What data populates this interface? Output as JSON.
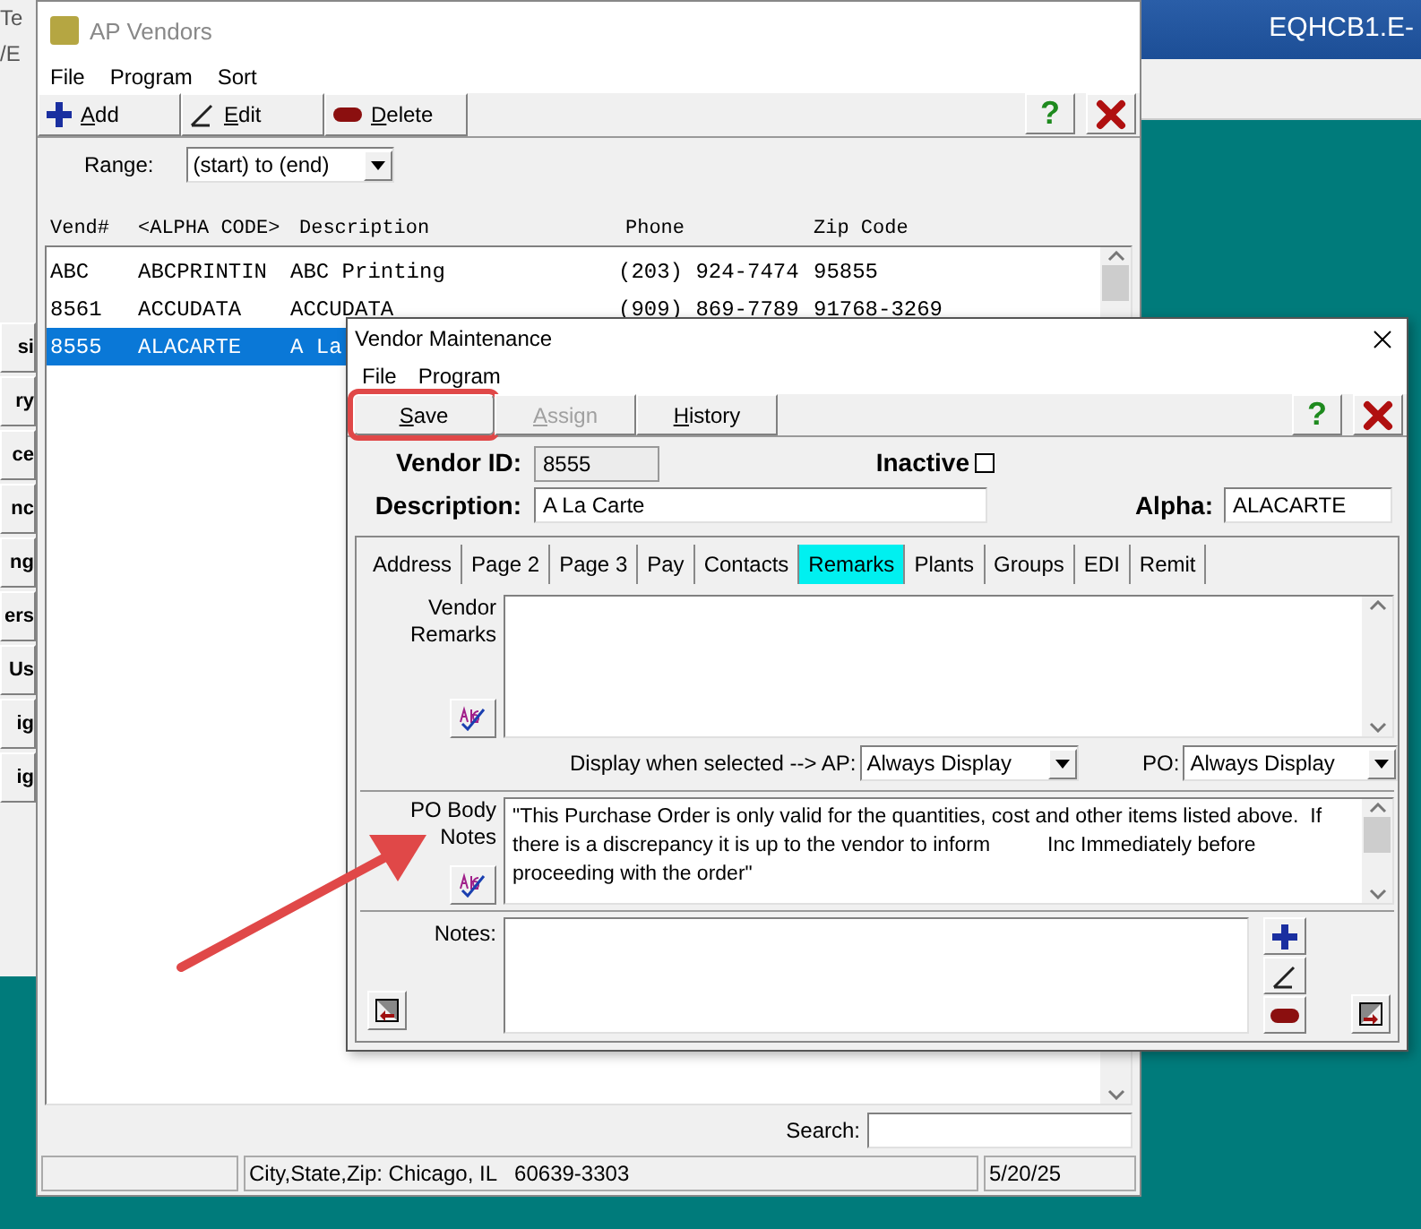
{
  "background_window": {
    "title_fragment": "EQHCB1.E-",
    "left_fragments": [
      "Te",
      "/E"
    ],
    "side_buttons": [
      "si",
      "ry",
      "ce",
      "nc",
      "ng",
      "ers",
      "Us",
      "ig",
      "ig"
    ]
  },
  "ap_vendors": {
    "title": "AP Vendors",
    "menu": [
      "File",
      "Program",
      "Sort"
    ],
    "toolbar": [
      {
        "label": "Add",
        "kind": "add"
      },
      {
        "label": "Edit",
        "kind": "edit"
      },
      {
        "label": "Delete",
        "kind": "delete"
      }
    ],
    "range": {
      "label": "Range:",
      "value": "(start) to (end)"
    },
    "columns": [
      "Vend#",
      "<ALPHA CODE>",
      "Description",
      "Phone",
      "Zip Code"
    ],
    "rows": [
      {
        "vend": "ABC",
        "alpha": "ABCPRINTIN",
        "description": "ABC Printing",
        "phone": "(203) 924-7474",
        "zip": "95855",
        "selected": false
      },
      {
        "vend": "8561",
        "alpha": "ACCUDATA",
        "description": "ACCUDATA",
        "phone": "(909) 869-7789",
        "zip": "91768-3269",
        "selected": false
      },
      {
        "vend": "8555",
        "alpha": "ALACARTE",
        "description": "A La",
        "selected": true
      }
    ],
    "search": {
      "label": "Search:"
    },
    "status_bar": [
      "City,State,Zip: Chicago, IL   60639-3303",
      "5/20/25"
    ]
  },
  "vendor_maintenance": {
    "title": "Vendor Maintenance",
    "menu": [
      "File",
      "Program"
    ],
    "toolbar": [
      {
        "label": "Save",
        "disabled": false
      },
      {
        "label": "Assign",
        "disabled": true
      },
      {
        "label": "History",
        "disabled": false
      }
    ],
    "help_glyph": "?",
    "vendor_id": {
      "label": "Vendor ID:",
      "value": "8555"
    },
    "inactive": {
      "label": "Inactive",
      "checked": false
    },
    "description": {
      "label": "Description:",
      "value": "A La Carte"
    },
    "alpha": {
      "label": "Alpha:",
      "value": "ALACARTE"
    },
    "tabs": [
      {
        "label": "Address",
        "selected": false
      },
      {
        "label": "Page 2",
        "selected": false
      },
      {
        "label": "Page 3",
        "selected": false
      },
      {
        "label": "Pay",
        "selected": false
      },
      {
        "label": "Contacts",
        "selected": false
      },
      {
        "label": "Remarks",
        "selected": true
      },
      {
        "label": "Plants",
        "selected": false
      },
      {
        "label": "Groups",
        "selected": false
      },
      {
        "label": "EDI",
        "selected": false
      },
      {
        "label": "Remit",
        "selected": false
      }
    ],
    "vendor_remarks": {
      "label": "Vendor Remarks"
    },
    "display_row": {
      "label": "Display when selected --> AP:",
      "ap_value": "Always Display",
      "po_label": "PO:",
      "po_value": "Always Display"
    },
    "po_body_notes": {
      "label": "PO Body Notes",
      "value": "\"This Purchase Order is only valid for the quantities, cost and other items listed above.  If there is a discrepancy it is up to the vendor to inform          Inc Immediately before proceeding with the order\""
    },
    "notes": {
      "label": "Notes:"
    }
  }
}
